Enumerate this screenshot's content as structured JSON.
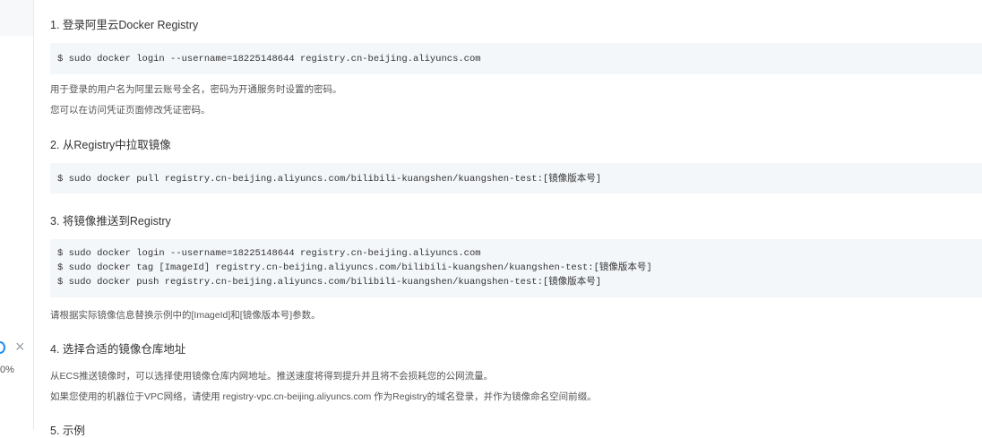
{
  "sidebar": {
    "percent_text": "0%",
    "info_icon": "info-circle-icon",
    "close_icon": "close-icon"
  },
  "steps": [
    {
      "title": "1. 登录阿里云Docker Registry",
      "code": [
        "$ sudo docker login --username=18225148644 registry.cn-beijing.aliyuncs.com"
      ],
      "notes": [
        "用于登录的用户名为阿里云账号全名，密码为开通服务时设置的密码。",
        "您可以在访问凭证页面修改凭证密码。"
      ]
    },
    {
      "title": "2. 从Registry中拉取镜像",
      "code": [
        "$ sudo docker pull registry.cn-beijing.aliyuncs.com/bilibili-kuangshen/kuangshen-test:[镜像版本号]"
      ],
      "notes": []
    },
    {
      "title": "3. 将镜像推送到Registry",
      "code": [
        "$ sudo docker login --username=18225148644 registry.cn-beijing.aliyuncs.com",
        "$ sudo docker tag [ImageId] registry.cn-beijing.aliyuncs.com/bilibili-kuangshen/kuangshen-test:[镜像版本号]",
        "$ sudo docker push registry.cn-beijing.aliyuncs.com/bilibili-kuangshen/kuangshen-test:[镜像版本号]"
      ],
      "notes": [
        "请根据实际镜像信息替换示例中的[ImageId]和[镜像版本号]参数。"
      ]
    },
    {
      "title": "4. 选择合适的镜像仓库地址",
      "code": [],
      "notes": [
        "从ECS推送镜像时，可以选择使用镜像仓库内网地址。推送速度将得到提升并且将不会损耗您的公网流量。",
        "如果您使用的机器位于VPC网络，请使用 registry-vpc.cn-beijing.aliyuncs.com 作为Registry的域名登录，并作为镜像命名空间前缀。"
      ]
    },
    {
      "title": "5. 示例",
      "code": [],
      "notes": []
    }
  ],
  "colors": {
    "code_bg": "#f4f7fa",
    "accent": "#1e8ef1"
  }
}
